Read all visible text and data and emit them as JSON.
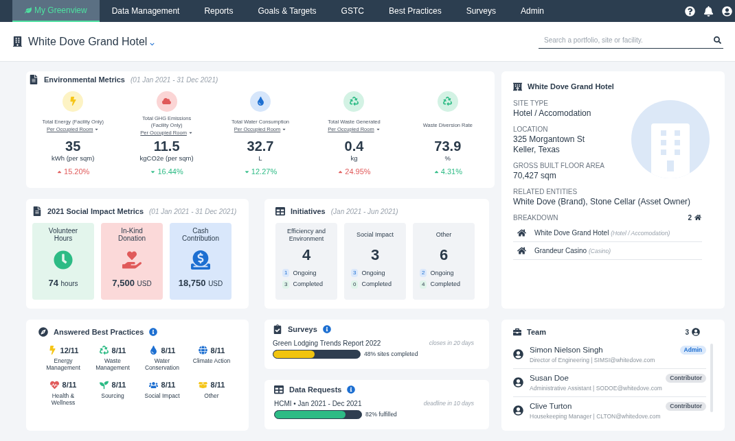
{
  "nav": {
    "items": [
      {
        "label": "My Greenview",
        "selected": true
      },
      {
        "label": "Data Management",
        "selected": false
      },
      {
        "label": "Reports",
        "selected": false
      },
      {
        "label": "Goals & Targets",
        "selected": false
      },
      {
        "label": "GSTC",
        "selected": false
      },
      {
        "label": "Best Practices",
        "selected": false
      },
      {
        "label": "Surveys",
        "selected": false
      },
      {
        "label": "Admin",
        "selected": false
      }
    ]
  },
  "header": {
    "site_name": "White Dove Grand Hotel",
    "search": {
      "placeholder": "Search a portfolio, site or facility."
    }
  },
  "env_metrics": {
    "title": "Environmental Metrics",
    "period": "(01 Jan 2021 - 31 Dec 2021)",
    "metrics": [
      {
        "kind": "energy",
        "label": "Total Energy (Facility Only)",
        "selector": "Per Occupied Room",
        "value": "35",
        "unit": "kWh (per sqm)",
        "change": "15.20%",
        "rising": true,
        "good": false
      },
      {
        "kind": "ghg",
        "label": "Total GHG Emissions (Facility Only)",
        "selector": "Per Occupied Room",
        "value": "11.5",
        "unit": "kgCO2e (per sqm)",
        "change": "16.44%",
        "rising": false,
        "good": true
      },
      {
        "kind": "water",
        "label": "Total Water Consumption",
        "selector": "Per Occupied Room",
        "value": "32.7",
        "unit": "L",
        "change": "12.27%",
        "rising": false,
        "good": true
      },
      {
        "kind": "waste",
        "label": "Total Waste Generated",
        "selector": "Per Occupied Room",
        "value": "0.4",
        "unit": "kg",
        "change": "24.95%",
        "rising": true,
        "good": false
      },
      {
        "kind": "diversion",
        "label": "Waste Diversion Rate",
        "value": "73.9",
        "unit": "%",
        "change": "4.31%",
        "rising": true,
        "good": true
      }
    ]
  },
  "social": {
    "title": "2021 Social Impact Metrics",
    "period": "(01 Jan 2021 - 31 Dec 2021)",
    "items": [
      {
        "kind": "volunteer",
        "label": "Volunteer Hours",
        "value": "74",
        "unit": "hours"
      },
      {
        "kind": "donation",
        "label": "In-Kind Donation",
        "value": "7,500",
        "unit": "USD"
      },
      {
        "kind": "cash",
        "label": "Cash Contribution",
        "value": "18,750",
        "unit": "USD"
      }
    ]
  },
  "initiatives": {
    "title": "Initiatives",
    "period": "(Jan 2021 - Jun 2021)",
    "groups": [
      {
        "label": "Efficiency and Environment",
        "count": "4",
        "stats": [
          {
            "kind": "ongoing",
            "count": "1",
            "label": "Ongoing"
          },
          {
            "kind": "completed",
            "count": "3",
            "label": "Completed"
          }
        ]
      },
      {
        "label": "Social Impact",
        "count": "3",
        "stats": [
          {
            "kind": "ongoing",
            "count": "3",
            "label": "Ongoing"
          },
          {
            "kind": "completed",
            "count": "0",
            "label": "Completed"
          }
        ]
      },
      {
        "label": "Other",
        "count": "6",
        "stats": [
          {
            "kind": "ongoing",
            "count": "2",
            "label": "Ongoing"
          },
          {
            "kind": "completed",
            "count": "4",
            "label": "Completed"
          }
        ]
      }
    ]
  },
  "best_practices": {
    "title": "Answered Best Practices",
    "items": [
      {
        "kind": "energy",
        "score": "12/11",
        "label": "Energy Management"
      },
      {
        "kind": "waste",
        "score": "8/11",
        "label": "Waste Management"
      },
      {
        "kind": "water",
        "score": "8/11",
        "label": "Water Conservation"
      },
      {
        "kind": "climate",
        "score": "8/11",
        "label": "Climate Action"
      },
      {
        "kind": "health",
        "score": "8/11",
        "label": "Health & Wellness"
      },
      {
        "kind": "sourcing",
        "score": "8/11",
        "label": "Sourcing"
      },
      {
        "kind": "social",
        "score": "8/11",
        "label": "Social Impact"
      },
      {
        "kind": "other",
        "score": "8/11",
        "label": "Other"
      }
    ]
  },
  "surveys": {
    "title": "Surveys",
    "name": "Green Lodging Trends Report 2022",
    "note": "closes in 20 days",
    "level": 0.48,
    "reading": "48% sites completed"
  },
  "data_requests": {
    "title": "Data Requests",
    "name": "HCMI • Jan 2021 - Dec 2021",
    "note": "deadline in 10 days",
    "level": 0.82,
    "reading": "82% fulfilled"
  },
  "site": {
    "title": "White Dove Grand Hotel",
    "fields": [
      {
        "label": "SITE TYPE",
        "value": "Hotel / Accomodation"
      },
      {
        "label": "LOCATION",
        "value": "325 Morgantown St\nKeller, Texas"
      },
      {
        "label": "GROSS BUILT FLOOR AREA",
        "value": "70,427 sqm"
      },
      {
        "label": "RELATED ENTITIES",
        "value": "White Dove (Brand), Stone Cellar (Asset Owner)"
      }
    ],
    "breakdown": {
      "label": "BREAKDOWN",
      "count": "2",
      "items": [
        {
          "name": "White Dove Grand Hotel",
          "type": "(Hotel / Accomodation)"
        },
        {
          "name": "Grandeur Casino",
          "type": "(Casino)"
        }
      ]
    }
  },
  "team": {
    "title": "Team",
    "count": "3",
    "members": [
      {
        "name": "Simon Nielson Singh",
        "detail": "Director of Engineering | SIMSI@whitedove.com",
        "role": "Admin",
        "kind": "admin"
      },
      {
        "name": "Susan Doe",
        "detail": "Administrative Assistant | SODOE@whitedove.com",
        "role": "Contributor",
        "kind": "contributor"
      },
      {
        "name": "Clive Turton",
        "detail": "Housekeeping Manager | CLTON@whitedove.com",
        "role": "Contributor",
        "kind": "contributor"
      }
    ]
  }
}
